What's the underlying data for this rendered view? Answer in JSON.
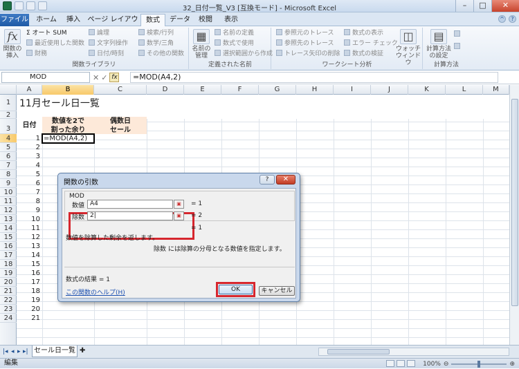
{
  "window": {
    "title": "32_日付一覧_V3 [互換モード] - Microsoft Excel",
    "min": "–",
    "max": "□",
    "close": "✕"
  },
  "tabs": [
    {
      "label": "ファイル"
    },
    {
      "label": "ホーム"
    },
    {
      "label": "挿入"
    },
    {
      "label": "ページ レイアウト"
    },
    {
      "label": "数式"
    },
    {
      "label": "データ"
    },
    {
      "label": "校閲"
    },
    {
      "label": "表示"
    }
  ],
  "ribbon": {
    "library": {
      "insert_function": "関数の\n挿入",
      "autosum": "Σ オート SUM",
      "recent": "最近使用した関数",
      "financial": "財務",
      "logical": "論理",
      "text": "文字列操作",
      "datetime": "日付/時刻",
      "lookup": "検索/行列",
      "math": "数学/三角",
      "other": "その他の関数",
      "label": "関数ライブラリ"
    },
    "names": {
      "name_manager": "名前の\n管理",
      "define_name": "名前の定義",
      "use_in_formula": "数式で使用",
      "create_from_selection": "選択範囲から作成",
      "label": "定義された名前"
    },
    "audit": {
      "trace_precedents": "参照元のトレース",
      "trace_dependents": "参照先のトレース",
      "remove_arrows": "トレース矢印の削除",
      "show_formulas": "数式の表示",
      "error_check": "エラー チェック",
      "evaluate": "数式の検証",
      "watch": "ウォッチ\nウィンドウ",
      "label": "ワークシート分析"
    },
    "calc": {
      "options": "計算方法\nの設定",
      "label": "計算方法"
    }
  },
  "formula_bar": {
    "name_box": "MOD",
    "formula": "=MOD(A4,2)",
    "fx": "fx"
  },
  "columns": [
    "A",
    "B",
    "C",
    "D",
    "E",
    "F",
    "G",
    "H",
    "I",
    "J",
    "K",
    "L",
    "M"
  ],
  "rows": [
    "1",
    "2",
    "3",
    "4",
    "5",
    "6",
    "7",
    "8",
    "9",
    "10",
    "11",
    "12",
    "13",
    "14",
    "15",
    "16",
    "17",
    "18",
    "19",
    "20",
    "21",
    "22",
    "23",
    "24"
  ],
  "sheet": {
    "title": "11月セール日一覧",
    "header_a": "日付",
    "header_b": "数値を2で\n割った余り",
    "header_c": "偶数日\nセール",
    "dates": [
      "1",
      "2",
      "3",
      "4",
      "5",
      "6",
      "7",
      "8",
      "9",
      "10",
      "11",
      "12",
      "13",
      "14",
      "15",
      "16",
      "17",
      "18",
      "19",
      "20",
      "21"
    ],
    "editing_cell": "=MOD(A4,2)"
  },
  "sheet_tab": "セール日一覧",
  "status": {
    "mode": "編集",
    "zoom": "100%"
  },
  "dialog": {
    "title": "関数の引数",
    "help_q": "?",
    "close": "✕",
    "function_name": "MOD",
    "arg1_label": "数値",
    "arg1_value": "A4",
    "arg1_result": "=  1",
    "arg2_label": "除数",
    "arg2_value": "2|",
    "arg2_result": "=  2",
    "result_line": "=  1",
    "description": "数値を除算した剰余を返します。",
    "arg_description": "除数  には除算の分母となる数値を指定します。",
    "formula_result": "数式の結果 =   1",
    "help_link": "この関数のヘルプ(H)",
    "ok": "OK",
    "cancel": "キャンセル"
  }
}
